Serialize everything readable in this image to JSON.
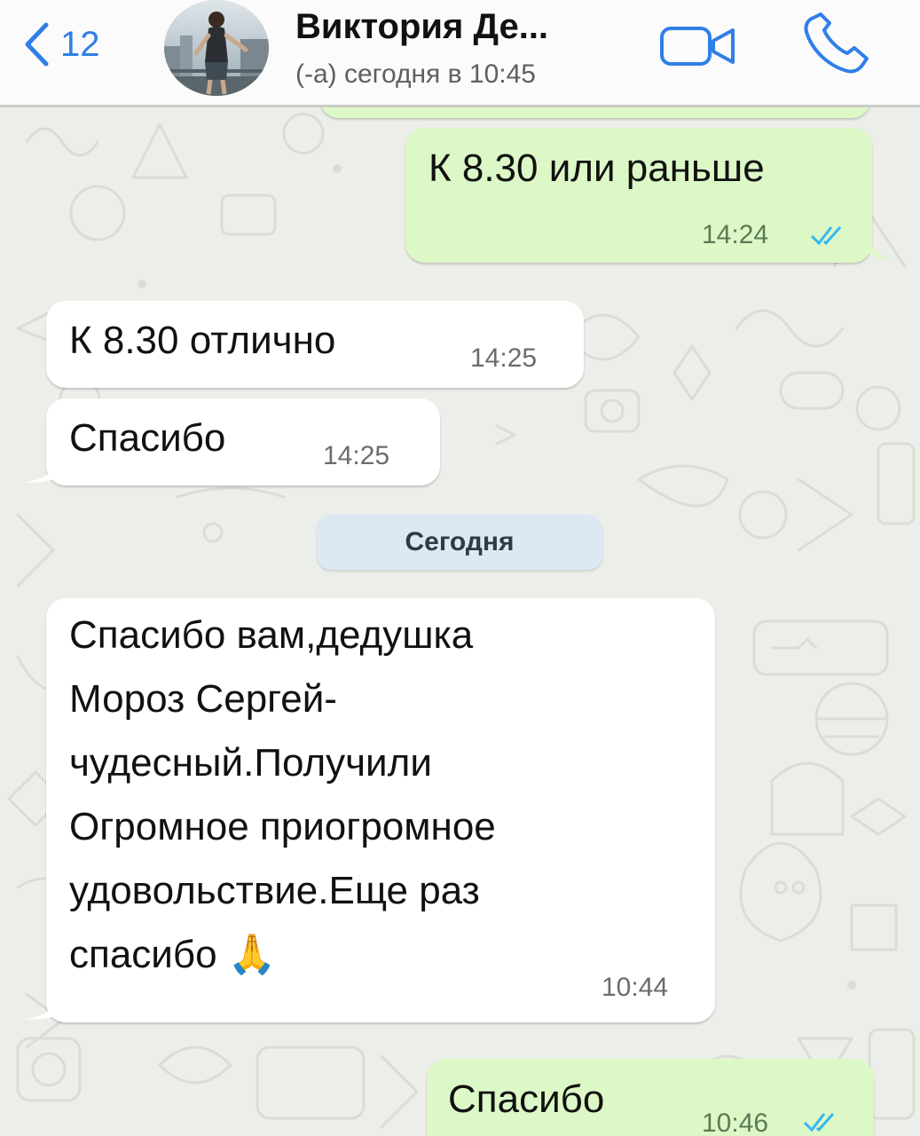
{
  "header": {
    "back_count": "12",
    "contact_name": "Виктория Де...",
    "last_seen": "(-а) сегодня в 10:45"
  },
  "messages": [
    {
      "direction": "out",
      "text": "К 8.30 или раньше",
      "time": "14:24",
      "status": "read"
    },
    {
      "direction": "in",
      "text": "К 8.30 отлично",
      "time": "14:25"
    },
    {
      "direction": "in",
      "text": "Спасибо",
      "time": "14:25"
    },
    {
      "direction": "in",
      "text": "Спасибо вам,дедушка\nМороз Сергей-\nчудесный.Получили\nОгромное приогромное\nудовольствие.Еще раз\nспасибо 🙏",
      "time": "10:44"
    },
    {
      "direction": "out",
      "text": "Спасибо",
      "time": "10:46",
      "status": "read"
    }
  ],
  "date_separator": "Сегодня",
  "colors": {
    "accent": "#2f7fe8",
    "outgoing_bubble": "#dcf8c6",
    "incoming_bubble": "#ffffff",
    "read_ticks": "#34b7f1",
    "date_chip": "#dce8f2"
  },
  "icons": {
    "back": "chevron-left-icon",
    "video": "video-camera-icon",
    "call": "phone-icon",
    "read": "double-check-icon",
    "emoji": "folded-hands-emoji"
  }
}
